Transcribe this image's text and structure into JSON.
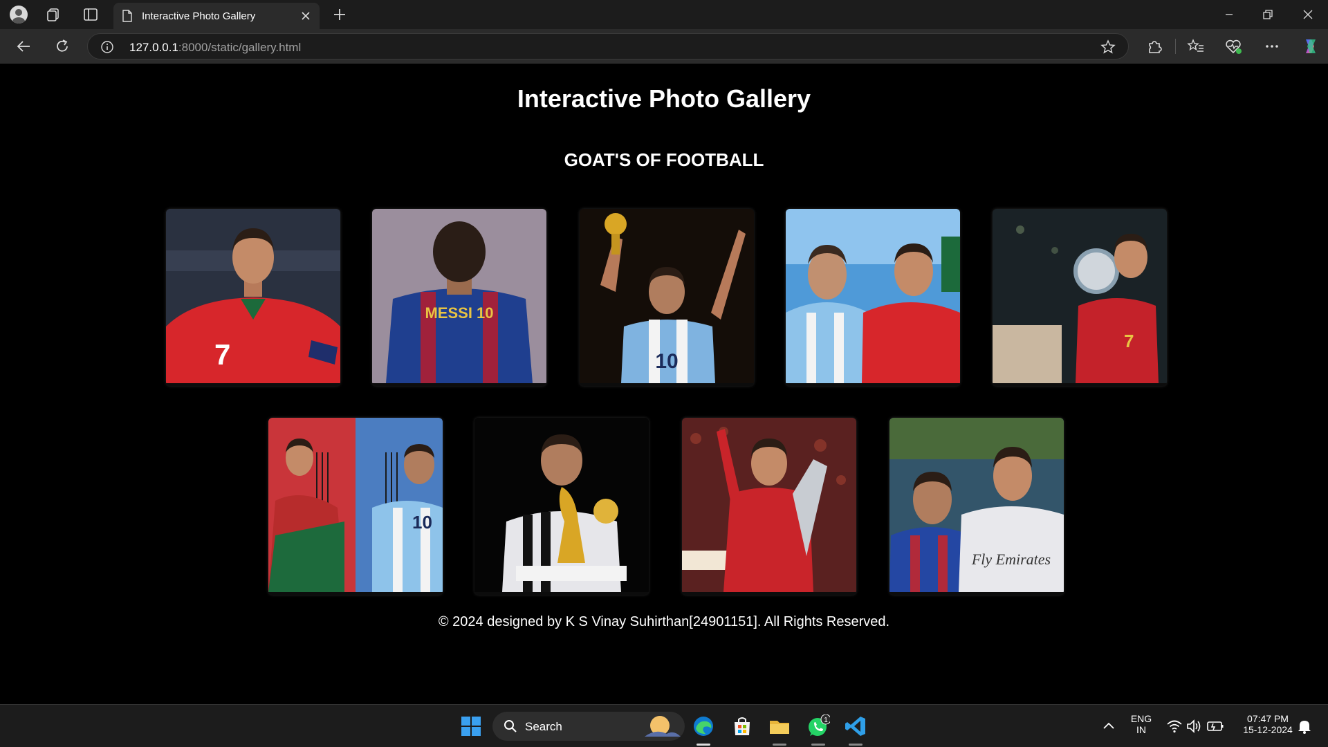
{
  "browser": {
    "tab_title": "Interactive Photo Gallery",
    "url_host": "127.0.0.1",
    "url_rest": ":8000/static/gallery.html"
  },
  "page": {
    "title": "Interactive Photo Gallery",
    "subtitle": "GOAT'S OF FOOTBALL",
    "footer": "© 2024 designed by K S Vinay Suhirthan[24901151]. All Rights Reserved."
  },
  "gallery": {
    "photos": [
      {
        "jersey_text": "7",
        "shirt_color": "#d7262b",
        "bg_color": "#2a3140"
      },
      {
        "jersey_text": "MESSI 10",
        "shirt_color": "#1f3f8f",
        "bg_color": "#9b8e9d"
      },
      {
        "jersey_text": "10",
        "shirt_color": "#7fb3e0",
        "bg_color": "#140d08"
      },
      {
        "jersey_text": "",
        "shirt_color": "#d7262b",
        "bg_color": "#4f9ad8"
      },
      {
        "jersey_text": "7",
        "shirt_color": "#c4222a",
        "bg_color": "#1a2226"
      },
      {
        "jersey_text": "10",
        "shirt_color": "#b72c2c",
        "bg_color": "#4b7dc1"
      },
      {
        "jersey_text": "",
        "shirt_color": "#e6e6ea",
        "bg_color": "#050505"
      },
      {
        "jersey_text": "",
        "shirt_color": "#c9242a",
        "bg_color": "#5a2120"
      },
      {
        "jersey_text": "Fly Emirates",
        "shirt_color": "#e8e8ec",
        "bg_color": "#33556a"
      }
    ]
  },
  "taskbar": {
    "search_label": "Search",
    "whatsapp_badge": "1",
    "language": "ENG",
    "region": "IN",
    "time": "07:47 PM",
    "date": "15-12-2024"
  }
}
